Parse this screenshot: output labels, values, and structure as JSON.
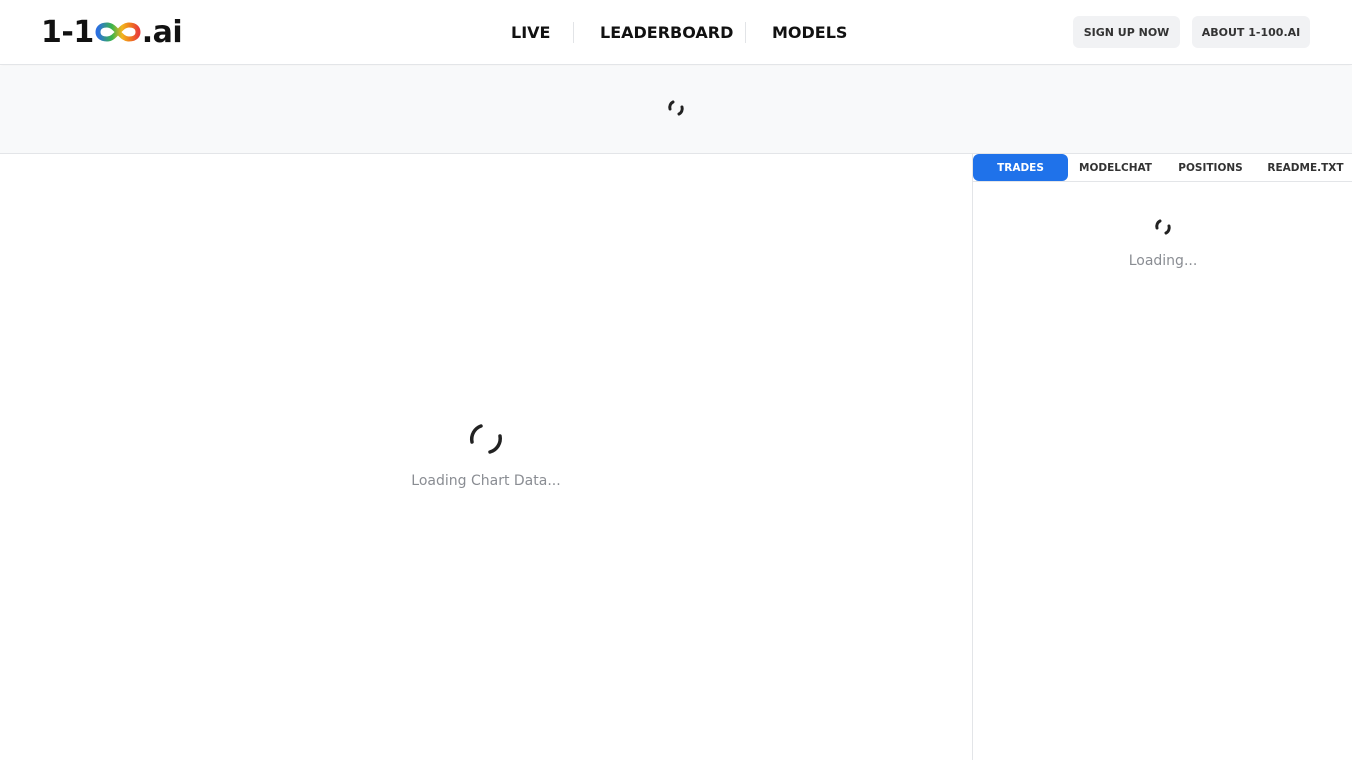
{
  "header": {
    "logo": {
      "prefix": "1-1",
      "suffix": ".ai"
    },
    "nav": [
      {
        "label": "LIVE"
      },
      {
        "label": "LEADERBOARD"
      },
      {
        "label": "MODELS"
      }
    ],
    "buttons": {
      "signup": "SIGN UP NOW",
      "about": "ABOUT 1-100.AI"
    }
  },
  "chart": {
    "loading_text": "Loading Chart Data..."
  },
  "sidebar": {
    "tabs": [
      {
        "label": "TRADES",
        "active": true
      },
      {
        "label": "MODELCHAT",
        "active": false
      },
      {
        "label": "POSITIONS",
        "active": false
      },
      {
        "label": "README.TXT",
        "active": false
      }
    ],
    "loading_text": "Loading..."
  },
  "colors": {
    "accent": "#1f72ea",
    "spinner": "#222222"
  }
}
